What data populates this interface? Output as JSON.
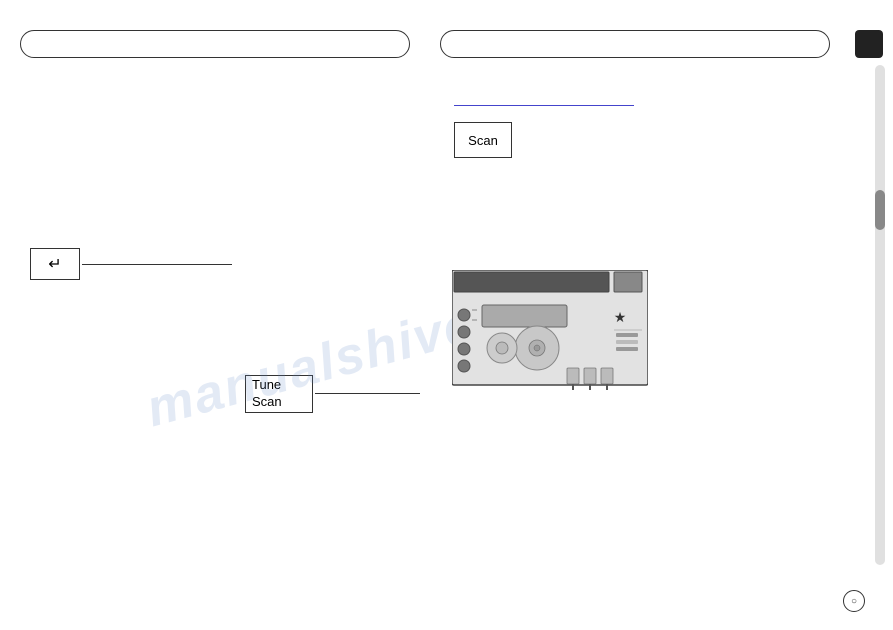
{
  "topbars": {
    "left_placeholder": "",
    "right_placeholder": ""
  },
  "scan_label": "Scan",
  "enter_key_symbol": "↵",
  "tune_scan": {
    "line1": "Tune",
    "line2": "Scan"
  },
  "watermark": "manualshive.com",
  "page_number": "○",
  "device": {
    "description": "Car stereo head unit illustration"
  }
}
